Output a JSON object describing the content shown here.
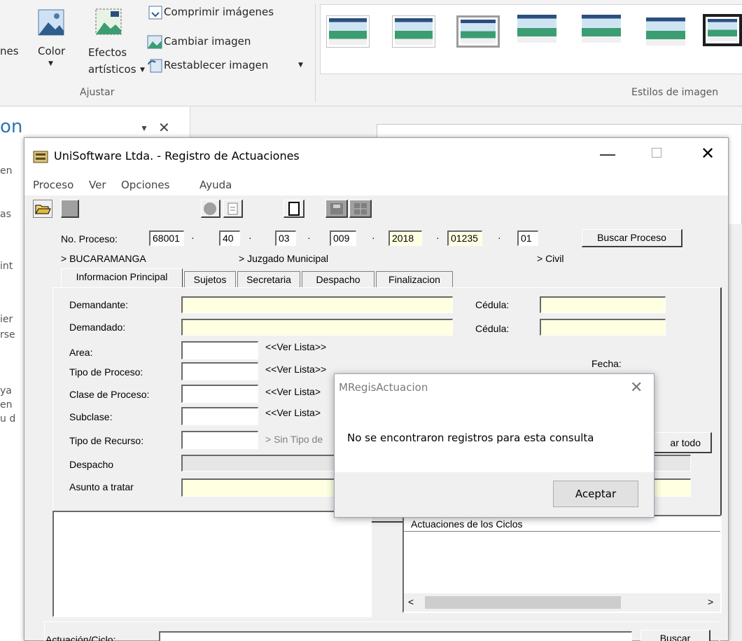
{
  "ribbon": {
    "cut_label": "nes",
    "color_label": "Color",
    "effects_label_1": "Efectos",
    "effects_label_2": "artísticos",
    "compress_label": "Comprimir imágenes",
    "change_label": "Cambiar imagen",
    "reset_label": "Restablecer imagen",
    "adjust_group": "Ajustar",
    "styles_group": "Estilos de imagen"
  },
  "side": {
    "partial_title": "on",
    "fragments": [
      "en",
      "as",
      "int",
      "ier",
      "rse",
      "ya",
      "en",
      "u d"
    ]
  },
  "window": {
    "title": "UniSoftware Ltda. - Registro de Actuaciones",
    "menu": [
      "Proceso",
      "Ver",
      "Opciones",
      "Ayuda"
    ]
  },
  "proceso": {
    "label": "No. Proceso:",
    "parts": [
      "68001",
      "40",
      "03",
      "009",
      "2018",
      "01235",
      "01"
    ],
    "sep": "·",
    "search_button": "Buscar Proceso",
    "city": "> BUCARAMANGA",
    "court": "> Juzgado Municipal",
    "type": "> Civil"
  },
  "tabs": [
    "Informacion Principal",
    "Sujetos",
    "Secretaria",
    "Despacho",
    "Finalizacion"
  ],
  "form": {
    "demandante": "Demandante:",
    "demandado": "Demandado:",
    "cedula": "Cédula:",
    "area": "Area:",
    "tipo_proceso": "Tipo de Proceso:",
    "clase_proceso": "Clase de Proceso:",
    "subclase": "Subclase:",
    "tipo_recurso": "Tipo de Recurso:",
    "despacho": "Despacho",
    "asunto": "Asunto a tratar",
    "ver_lista": "<<Ver Lista>>",
    "ver_lista_cut": "<<Ver Lista>",
    "sin_tipo": "> Sin Tipo de",
    "fecha": "Fecha:",
    "borrar_todo_cut": "ar todo"
  },
  "lower": {
    "ciclos_header": "Actuaciones de los Ciclos",
    "actuacion_label": "Actuación/Ciclo:",
    "buscar": "Buscar"
  },
  "dialog": {
    "title": "MRegisActuacion",
    "message": "No se encontraron registros para esta consulta",
    "ok": "Aceptar"
  }
}
